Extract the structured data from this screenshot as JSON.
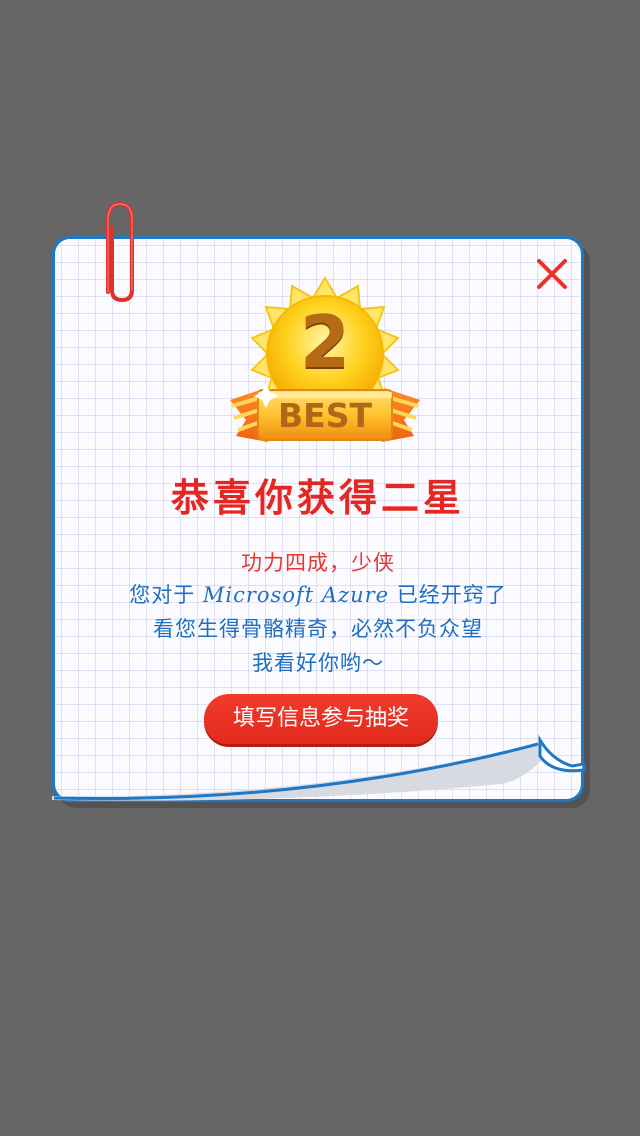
{
  "badge": {
    "number": "2",
    "label": "BEST"
  },
  "dialog": {
    "title": "恭喜你获得二星",
    "message_line1": "功力四成，少侠",
    "message_line2_prefix": "您对于 ",
    "message_line2_product": "Microsoft Azure",
    "message_line2_suffix": " 已经开窍了",
    "message_line3": "看您生得骨骼精奇，必然不负众望",
    "message_line4": "我看好你哟～",
    "cta_label": "填写信息参与抽奖"
  },
  "icons": {
    "close": "close-icon",
    "clip": "paperclip-icon",
    "badge": "star-badge-icon"
  },
  "colors": {
    "background": "#666666",
    "card_border": "#1e78c8",
    "title_red": "#e42722",
    "text_blue": "#1f6fc0",
    "button_red": "#e8302a"
  }
}
